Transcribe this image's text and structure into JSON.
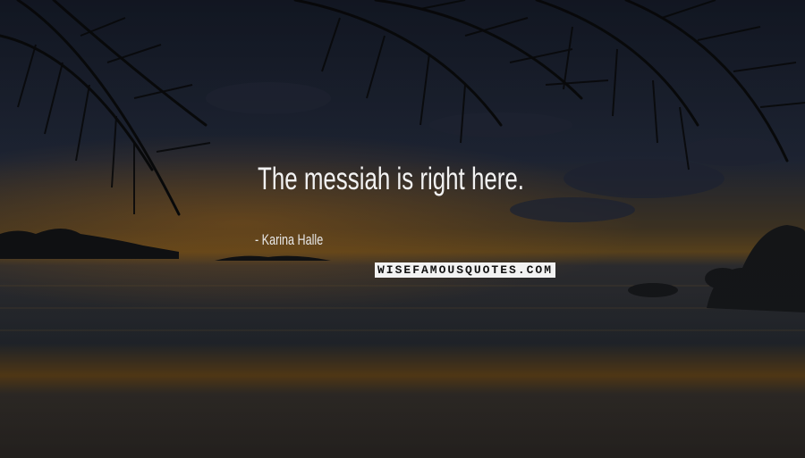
{
  "quote": {
    "text": "The messiah is right here.",
    "author": "- Karina Halle"
  },
  "watermark": {
    "text": "WISEFAMOUSQUOTES.COM"
  },
  "colors": {
    "text": "#f2f2f2",
    "sky_top": "#1e2535",
    "sunset_glow": "#c07a22",
    "sea": "#2a3038",
    "sand": "#3a3530"
  }
}
